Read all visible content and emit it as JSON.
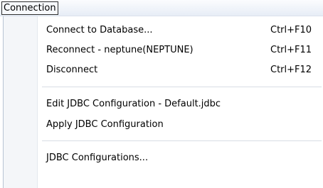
{
  "menubar": {
    "title": "Connection"
  },
  "menu": {
    "items": [
      {
        "label": "Connect to Database...",
        "shortcut": "Ctrl+F10"
      },
      {
        "label": "Reconnect - neptune(NEPTUNE)",
        "shortcut": "Ctrl+F11"
      },
      {
        "label": "Disconnect",
        "shortcut": "Ctrl+F12"
      },
      {
        "label": "Edit JDBC Configuration - Default.jdbc"
      },
      {
        "label": "Apply JDBC Configuration"
      },
      {
        "label": "JDBC Configurations..."
      }
    ]
  }
}
